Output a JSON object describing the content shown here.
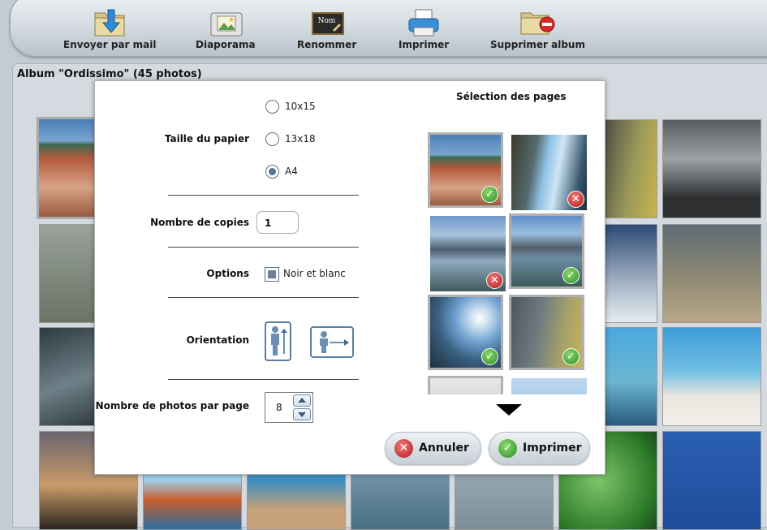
{
  "toolbar": {
    "items": [
      {
        "label": "Envoyer par mail",
        "icon": "mail-folder-icon"
      },
      {
        "label": "Diaporama",
        "icon": "slideshow-icon"
      },
      {
        "label": "Renommer",
        "icon": "rename-board-icon"
      },
      {
        "label": "Imprimer",
        "icon": "printer-icon"
      },
      {
        "label": "Supprimer album",
        "icon": "delete-folder-icon"
      }
    ],
    "rename_board_text": "Nom"
  },
  "album": {
    "title": "Album \"Ordissimo\" (45 photos)"
  },
  "dialog": {
    "paper_size": {
      "label": "Taille du papier",
      "options": [
        "10x15",
        "13x18",
        "A4"
      ],
      "selected": "A4"
    },
    "copies": {
      "label": "Nombre de copies",
      "value": "1"
    },
    "options": {
      "label": "Options",
      "checkbox_label": "Noir et blanc",
      "checked": true
    },
    "orientation": {
      "label": "Orientation",
      "selected": "portrait"
    },
    "photos_per_page": {
      "label": "Nombre de photos par page",
      "value": "8"
    },
    "pages": {
      "title": "Sélection des pages",
      "items": [
        {
          "selected": true,
          "status": "ok"
        },
        {
          "selected": false,
          "status": "no"
        },
        {
          "selected": false,
          "status": "no"
        },
        {
          "selected": true,
          "status": "ok"
        },
        {
          "selected": true,
          "status": "ok"
        },
        {
          "selected": true,
          "status": "ok"
        }
      ]
    },
    "cancel_label": "Annuler",
    "print_label": "Imprimer"
  },
  "colors": {
    "accent": "#5a7592",
    "ok_green": "#2f8f22",
    "cancel_red": "#b31818"
  }
}
